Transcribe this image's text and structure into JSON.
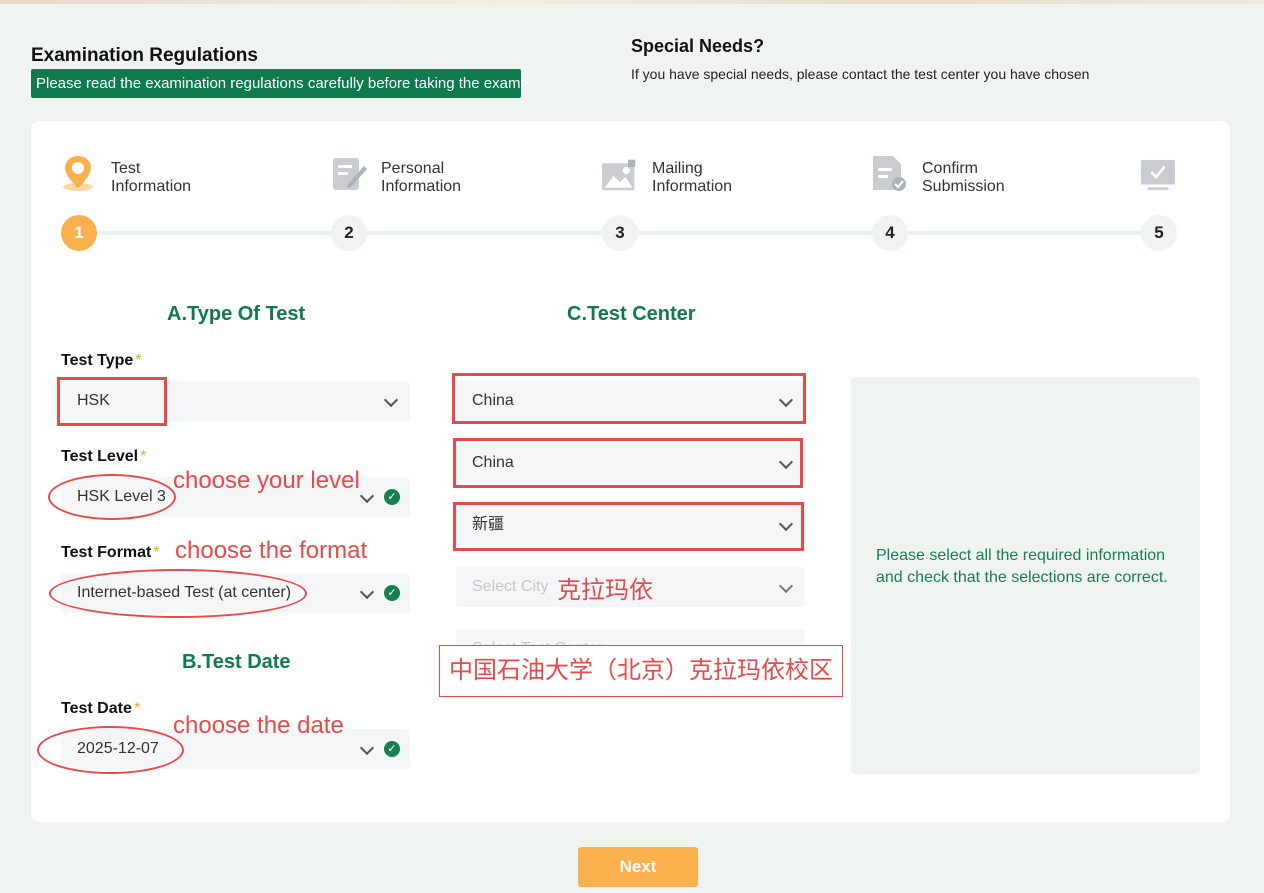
{
  "regulations": {
    "title": "Examination Regulations",
    "banner": "Please read the examination regulations carefully before taking the exam>"
  },
  "special_needs": {
    "title": "Special Needs?",
    "text": "If you have special needs, please contact the test center you have chosen"
  },
  "steps": [
    {
      "number": "1",
      "line1": "Test",
      "line2": "Information",
      "icon": "location-pin-icon",
      "active": true
    },
    {
      "number": "2",
      "line1": "Personal",
      "line2": "Information",
      "icon": "edit-form-icon",
      "active": false
    },
    {
      "number": "3",
      "line1": "Mailing",
      "line2": "Information",
      "icon": "photo-image-icon",
      "active": false
    },
    {
      "number": "4",
      "line1": "Confirm",
      "line2": "Submission",
      "icon": "document-check-icon",
      "active": false
    },
    {
      "number": "5",
      "line1": "",
      "line2": "",
      "icon": "monitor-check-icon",
      "active": false
    }
  ],
  "section_a": {
    "title": "A.Type Of Test",
    "test_type_label": "Test Type",
    "test_type_value": "HSK",
    "test_level_label": "Test Level",
    "test_level_value": "HSK Level 3",
    "test_format_label": "Test Format",
    "test_format_value": "Internet-based Test (at center)"
  },
  "section_b": {
    "title": "B.Test Date",
    "test_date_label": "Test Date",
    "test_date_value": "2025-12-07"
  },
  "section_c": {
    "title": "C.Test Center",
    "country": "China",
    "region": "China",
    "province": "新疆",
    "city_placeholder": "Select City",
    "center_placeholder": "Select Test Center"
  },
  "hint": "Please select all the required information and check that the selections are correct.",
  "required_mark": "*",
  "annotations": {
    "level": "choose your level",
    "format": "choose the format",
    "date": "choose the date",
    "city": "克拉玛依",
    "center": "中国石油大学（北京）克拉玛依校区"
  },
  "next_button": "Next",
  "colors": {
    "brand_green": "#0e7a4e",
    "accent_orange": "#f9b04d",
    "annotation_red": "#e84a4a"
  }
}
